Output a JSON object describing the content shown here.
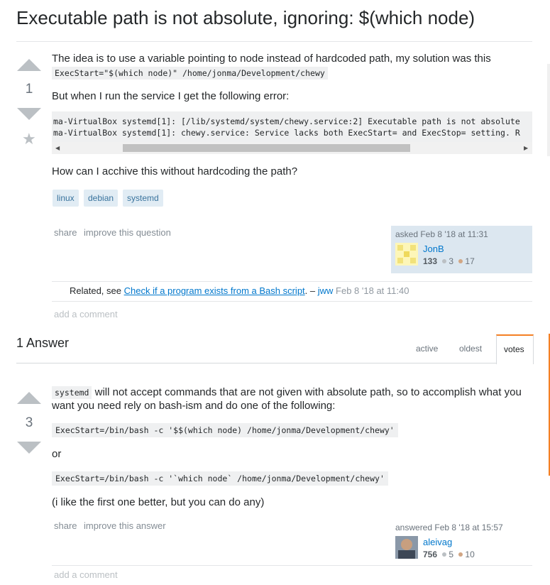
{
  "question": {
    "title": "Executable path is not absolute, ignoring: $(which node)",
    "score": "1",
    "intro": "The idea is to use a variable pointing to node instead of hardcoded path, my solution was this",
    "inline_code": "ExecStart=\"$(which node)\" /home/jonma/Development/chewy",
    "error_intro": "But when I run the service I get the following error:",
    "error_lines": [
      "ma-VirtualBox systemd[1]: [/lib/systemd/system/chewy.service:2] Executable path is not absolute",
      "ma-VirtualBox systemd[1]: chewy.service: Service lacks both ExecStart= and ExecStop= setting. R"
    ],
    "question_text": "How can I acchive this without hardcoding the path?",
    "tags": [
      "linux",
      "debian",
      "systemd"
    ],
    "share": "share",
    "improve": "improve this question",
    "asked": "asked Feb 8 '18 at 11:31",
    "user": {
      "name": "JonB",
      "rep": "133",
      "silver": "3",
      "bronze": "17"
    }
  },
  "comment": {
    "prefix": "Related, see",
    "link": "Check if a program exists from a Bash script",
    "suffix": ". –",
    "user": "jww",
    "time": "Feb 8 '18 at 11:40"
  },
  "add_comment": "add a comment",
  "answers_header": {
    "title": "1 Answer",
    "tabs": [
      "active",
      "oldest",
      "votes"
    ]
  },
  "answer": {
    "score": "3",
    "code_word": "systemd",
    "line1": " will not accept commands that are not given with absolute path, so to accomplish what you",
    "line2": "want you need rely on bash-ism and do one of the following:",
    "code1": "ExecStart=/bin/bash -c '$$(which node) /home/jonma/Development/chewy'",
    "or": "or",
    "code2": "ExecStart=/bin/bash -c '`which node` /home/jonma/Development/chewy'",
    "closing": "(i like the first one better, but you can do any)",
    "share": "share",
    "improve": "improve this answer",
    "answered": "answered Feb 8 '18 at 15:57",
    "user": {
      "name": "aleivag",
      "rep": "756",
      "silver": "5",
      "bronze": "10"
    }
  },
  "colors": {
    "accent": "#0077cc",
    "silver": "#bbc0c4",
    "bronze": "#d1a684",
    "tab_active": "#f48024"
  }
}
